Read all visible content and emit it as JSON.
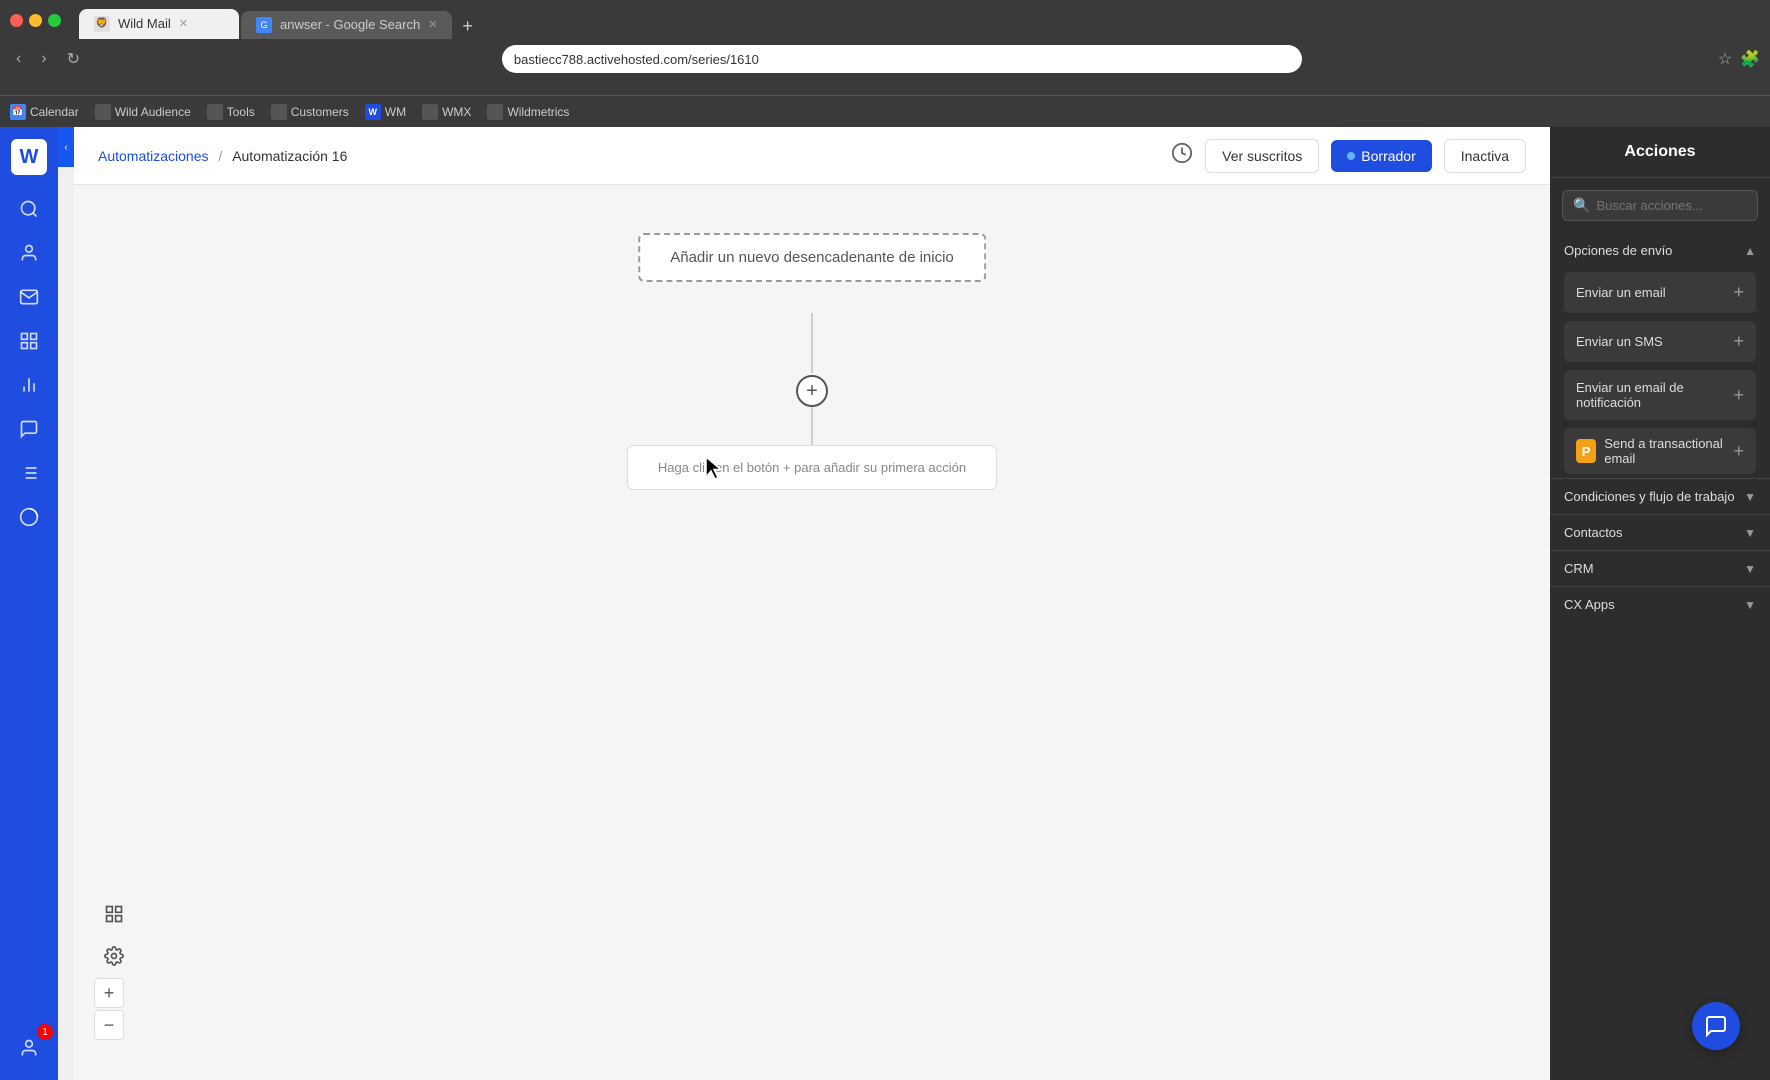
{
  "browser": {
    "tab1_title": "Wild Mail",
    "tab2_title": "anwser - Google Search",
    "address": "bastiecc788.activehosted.com/series/1610",
    "bookmarks": [
      "Calendar",
      "Wild Audience",
      "Tools",
      "Customers",
      "WM",
      "WMX",
      "Wildmetrics"
    ]
  },
  "topbar": {
    "breadcrumb_root": "Automatizaciones",
    "breadcrumb_sep": "/",
    "breadcrumb_current": "Automatización 16",
    "btn_ver_suscritos": "Ver suscritos",
    "btn_borrador": "Borrador",
    "btn_inactiva": "Inactiva"
  },
  "canvas": {
    "node_start_label": "Añadir un nuevo desencadenante de inicio",
    "node_hint_label": "Haga clic en el botón + para añadir su primera acción",
    "add_step_icon": "+"
  },
  "zoom": {
    "plus": "+",
    "minus": "−"
  },
  "panel": {
    "title": "Acciones",
    "search_placeholder": "Buscar acciones...",
    "section_envio": "Opciones de envío",
    "action1": "Enviar un email",
    "action2": "Enviar un SMS",
    "action3": "Enviar un email de notificación",
    "action4": "Send a transactional email",
    "section_condiciones": "Condiciones y flujo de trabajo",
    "section_contactos": "Contactos",
    "section_crm": "CRM",
    "section_cx_apps": "CX Apps",
    "postmark_icon_letter": "P"
  },
  "logo": {
    "letter": "W"
  },
  "notification": {
    "count": "1"
  }
}
